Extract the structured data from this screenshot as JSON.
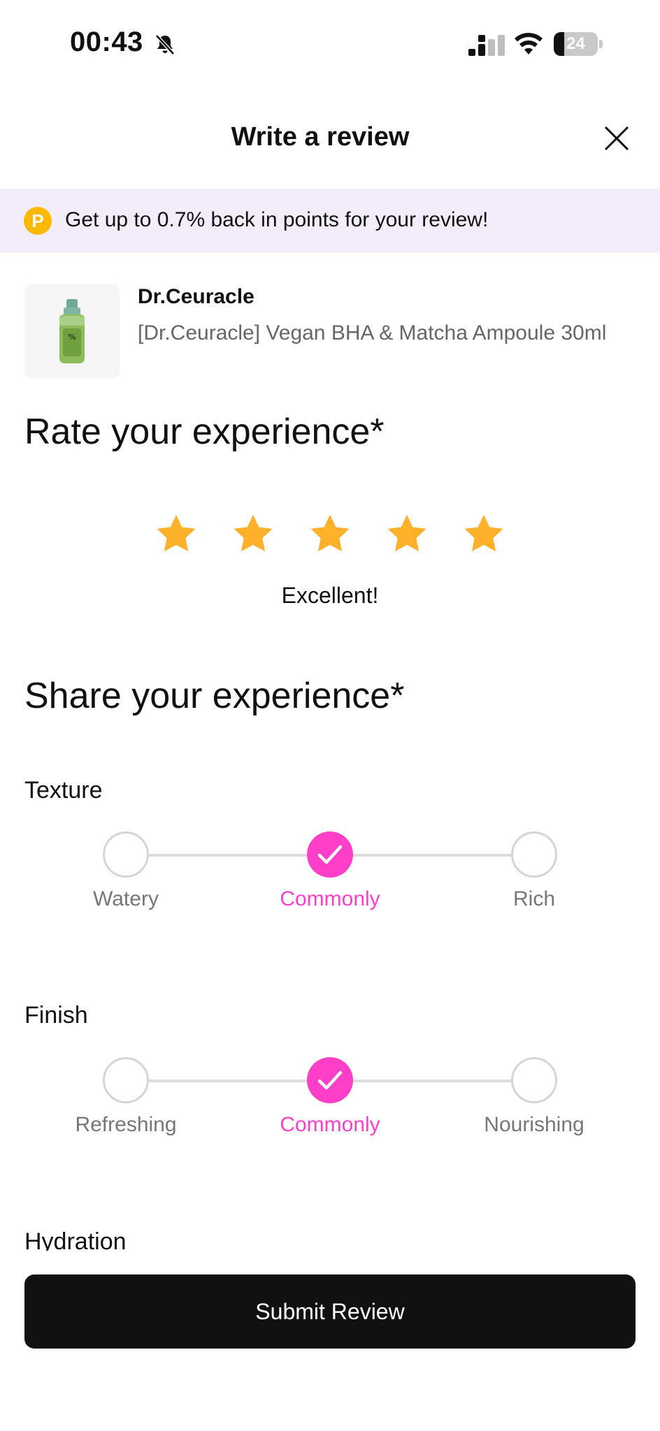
{
  "status_bar": {
    "time": "00:43",
    "battery": "24",
    "battery_level": 0.24,
    "icons": [
      "bell-slash-icon",
      "cellular-signal-icon",
      "wifi-icon",
      "battery-icon"
    ]
  },
  "header": {
    "title": "Write a review",
    "close_icon": "close-icon"
  },
  "banner": {
    "badge": "P",
    "text": "Get up to 0.7% back in points for your review!",
    "background": "#f3ecfb",
    "badge_color": "#ffb800"
  },
  "product": {
    "brand": "Dr.Ceuracle",
    "name": "[Dr.Ceuracle] Vegan BHA & Matcha Ampoule 30ml"
  },
  "rating": {
    "title": "Rate your experience*",
    "stars": 5,
    "max_stars": 5,
    "label": "Excellent!",
    "star_color": "#ffb12b"
  },
  "share": {
    "title": "Share your experience*",
    "accent": "#ff3fc8",
    "attributes": [
      {
        "label": "Texture",
        "options": [
          "Watery",
          "Commonly",
          "Rich"
        ],
        "selected_index": 1
      },
      {
        "label": "Finish",
        "options": [
          "Refreshing",
          "Commonly",
          "Nourishing"
        ],
        "selected_index": 1
      }
    ],
    "next_attribute": "Hydration"
  },
  "submit": {
    "label": "Submit Review"
  }
}
